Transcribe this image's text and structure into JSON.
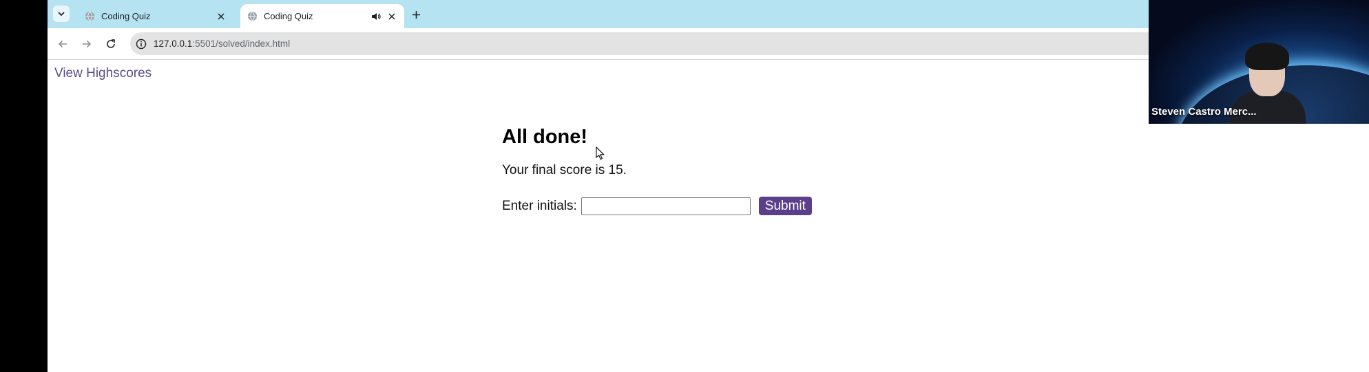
{
  "browser": {
    "tabs": [
      {
        "title": "Coding Quiz",
        "active": false
      },
      {
        "title": "Coding Quiz",
        "active": true,
        "playing_audio": true
      }
    ],
    "address": {
      "host": "127.0.0.1",
      "path": ":5501/solved/index.html"
    }
  },
  "page": {
    "highscores_link": "View Highscores",
    "heading": "All done!",
    "score_text": "Your final score is 15.",
    "initials_label": "Enter initials:",
    "initials_value": "",
    "submit_label": "Submit"
  },
  "webcam": {
    "participant_name": "Steven Castro Merc..."
  },
  "colors": {
    "tabstrip": "#b5e3f1",
    "link": "#5a4e80",
    "submit_button": "#5b3f8a"
  }
}
